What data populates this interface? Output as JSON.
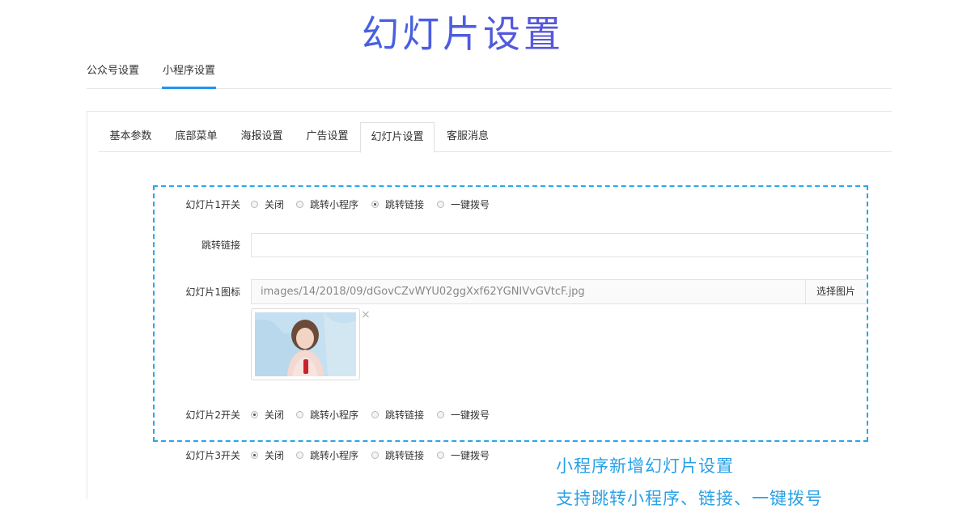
{
  "banner": {
    "title": "幻灯片设置"
  },
  "top_tabs": [
    {
      "label": "公众号设置"
    },
    {
      "label": "小程序设置"
    }
  ],
  "sub_tabs": [
    {
      "label": "基本参数"
    },
    {
      "label": "底部菜单"
    },
    {
      "label": "海报设置"
    },
    {
      "label": "广告设置"
    },
    {
      "label": "幻灯片设置"
    },
    {
      "label": "客服消息"
    }
  ],
  "form": {
    "slide1_switch_label": "幻灯片1开关",
    "jump_link_label": "跳转链接",
    "jump_link_value": "",
    "slide1_icon_label": "幻灯片1图标",
    "slide1_icon_path": "images/14/2018/09/dGovCZvWYU02ggXxf62YGNIVvGVtcF.jpg",
    "pick_image_label": "选择图片",
    "thumb_close": "×",
    "slide2_switch_label": "幻灯片2开关",
    "slide3_switch_label": "幻灯片3开关",
    "options": [
      "关闭",
      "跳转小程序",
      "跳转链接",
      "一键拨号"
    ],
    "slide1_selected": "跳转链接",
    "slide2_selected": "关闭",
    "slide3_selected": "关闭"
  },
  "promo": {
    "line1": "小程序新增幻灯片设置",
    "line2": "支持跳转小程序、链接、一键拨号"
  },
  "colors": {
    "accent": "#2196f3",
    "dash_border": "#2aa6ea",
    "promo_text": "#29a1e8"
  }
}
